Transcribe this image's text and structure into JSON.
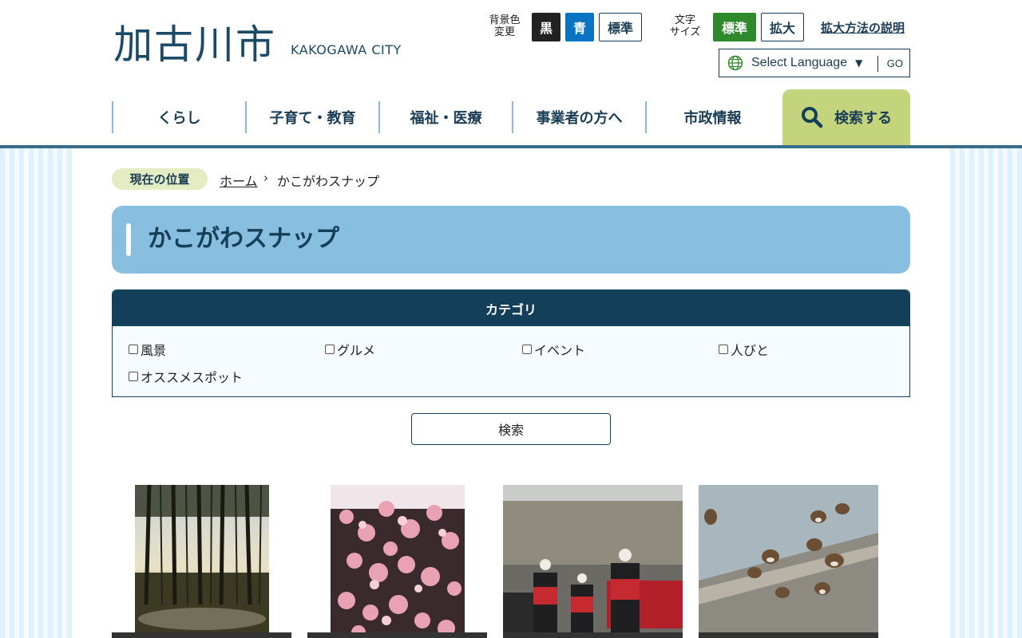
{
  "header": {
    "logo_jp": "加古川市",
    "logo_en": "KAKOGAWA CITY",
    "bg_color_label_1": "背景色",
    "bg_color_label_2": "変更",
    "bg_black": "黒",
    "bg_blue": "青",
    "bg_standard": "標準",
    "font_label_1": "文字",
    "font_label_2": "サイズ",
    "font_standard": "標準",
    "font_large": "拡大",
    "explain_link": "拡大方法の説明",
    "language_select": "Select Language",
    "language_go": "GO"
  },
  "nav": {
    "items": [
      "くらし",
      "子育て・教育",
      "福祉・医療",
      "事業者の方へ",
      "市政情報"
    ],
    "search": "検索する"
  },
  "breadcrumb": {
    "label": "現在の位置",
    "home": "ホーム",
    "separator": "›",
    "current": "かこがわスナップ"
  },
  "page": {
    "title": "かこがわスナップ"
  },
  "category": {
    "heading": "カテゴリ",
    "options": [
      "風景",
      "グルメ",
      "イベント",
      "人びと",
      "オススメスポット"
    ]
  },
  "search_button": "検索",
  "colors": {
    "brand_dark": "#143f5a",
    "title_bg": "#88bfe0",
    "nav_search_bg": "#c3d47d",
    "accent_green": "#2f8a2b",
    "accent_blue": "#0b74c2"
  }
}
